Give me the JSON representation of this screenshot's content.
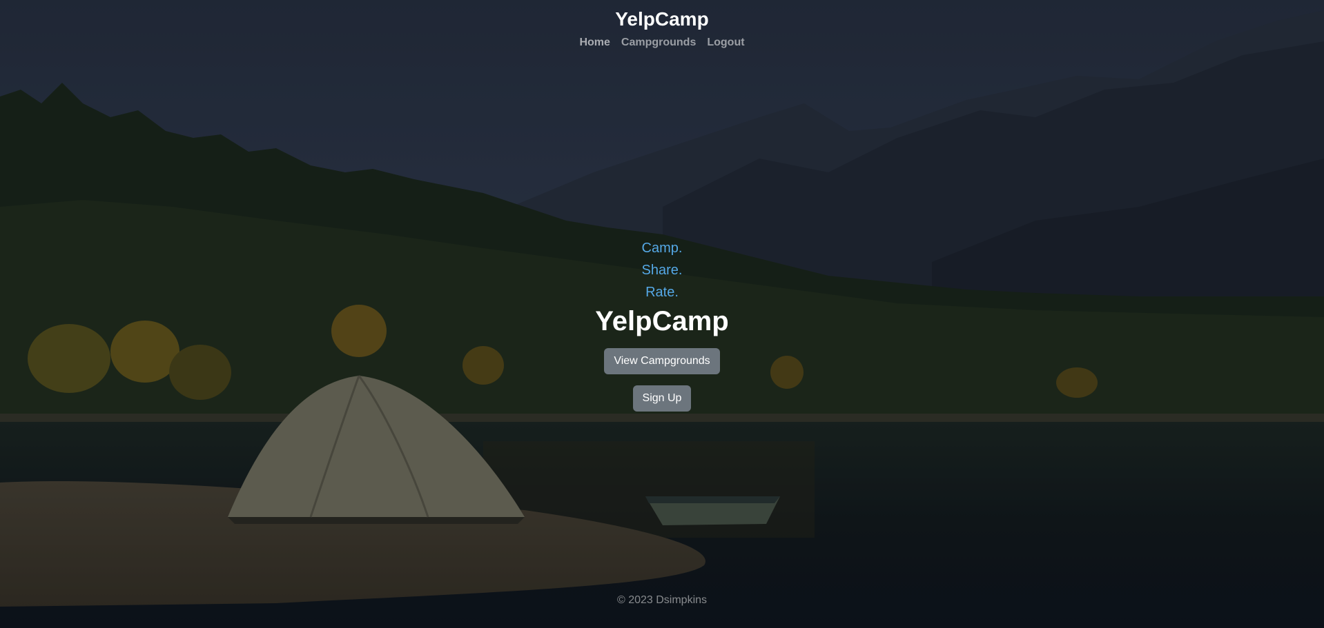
{
  "nav": {
    "brand": "YelpCamp",
    "links": [
      "Home",
      "Campgrounds",
      "Logout"
    ]
  },
  "hero": {
    "taglines": [
      "Camp.",
      "Share.",
      "Rate."
    ],
    "title": "YelpCamp",
    "view_button": "View Campgrounds",
    "signup_button": "Sign Up"
  },
  "footer": {
    "text": "© 2023 Dsimpkins"
  },
  "colors": {
    "tagline": "#55a8e6",
    "button": "#6c757d",
    "overlay": "rgba(0,0,0,0.5)"
  }
}
